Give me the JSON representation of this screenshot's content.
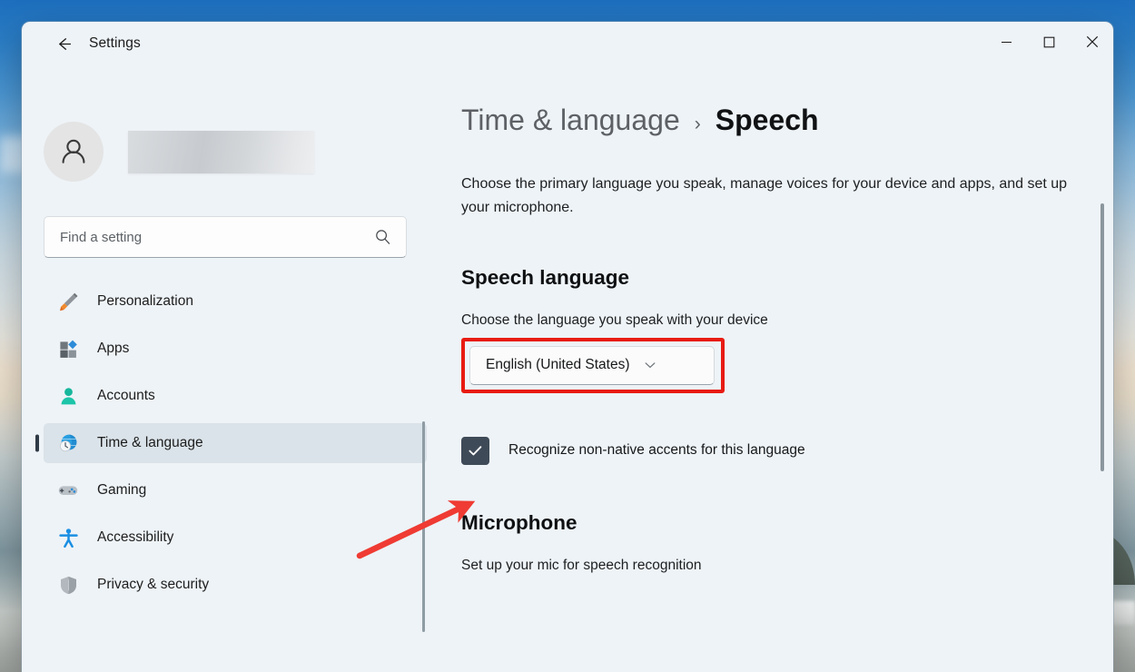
{
  "window": {
    "app_title": "Settings",
    "back_icon": "back-arrow-icon",
    "minimize_label": "—",
    "maximize_label": "□",
    "close_label": "✕"
  },
  "sidebar": {
    "account": {
      "avatar_icon": "user-avatar-icon",
      "name_redacted": ""
    },
    "search": {
      "placeholder": "Find a setting",
      "icon": "search-icon"
    },
    "items": [
      {
        "label": "Personalization",
        "icon": "paintbrush-icon",
        "selected": false
      },
      {
        "label": "Apps",
        "icon": "apps-grid-icon",
        "selected": false
      },
      {
        "label": "Accounts",
        "icon": "person-icon",
        "selected": false
      },
      {
        "label": "Time & language",
        "icon": "globe-clock-icon",
        "selected": true
      },
      {
        "label": "Gaming",
        "icon": "gamepad-icon",
        "selected": false
      },
      {
        "label": "Accessibility",
        "icon": "accessibility-person-icon",
        "selected": false
      },
      {
        "label": "Privacy & security",
        "icon": "shield-icon",
        "selected": false
      }
    ]
  },
  "main": {
    "breadcrumb": {
      "parent": "Time & language",
      "separator": "›",
      "current": "Speech"
    },
    "description": "Choose the primary language you speak, manage voices for your device and apps, and set up your microphone.",
    "speech_language": {
      "heading": "Speech language",
      "subtitle": "Choose the language you speak with your device",
      "selected_value": "English (United States)",
      "chevron_icon": "chevron-down-icon",
      "accent_checkbox_label": "Recognize non-native accents for this language",
      "accent_checkbox_checked": true
    },
    "microphone": {
      "heading": "Microphone",
      "subtitle": "Set up your mic for speech recognition"
    }
  },
  "annotations": {
    "highlight_color": "#e81b12",
    "arrow_color": "#ef3b33",
    "highlight_target": "language-dropdown",
    "arrow_target": "accent-checkbox"
  }
}
